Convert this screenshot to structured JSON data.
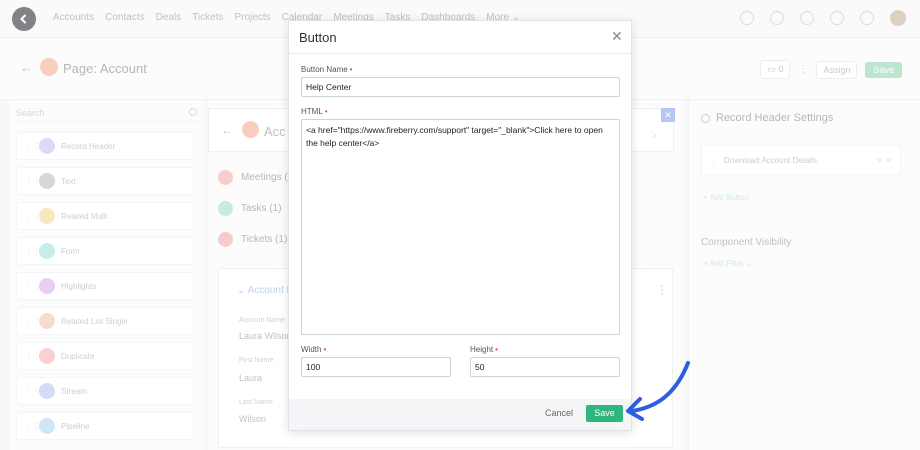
{
  "topnav": {
    "links": [
      "Accounts",
      "Contacts",
      "Deals",
      "Tickets",
      "Projects",
      "Calendar",
      "Meetings",
      "Tasks",
      "Dashboards",
      "More ⌄"
    ]
  },
  "pagebar": {
    "title": "Page: Account",
    "assign_label": "Assign",
    "save_label": "Save",
    "device_count": "0"
  },
  "left_panel": {
    "search_placeholder": "Search",
    "components": [
      {
        "label": "Record Header",
        "color": "#c7c9f3"
      },
      {
        "label": "Text",
        "color": "#bfc2c7"
      },
      {
        "label": "Related Multi",
        "color": "#f5dc9a"
      },
      {
        "label": "Form",
        "color": "#a9e3dd"
      },
      {
        "label": "Highlights",
        "color": "#d9b7ef"
      },
      {
        "label": "Related List Single",
        "color": "#f3c9b1"
      },
      {
        "label": "Duplicate",
        "color": "#f6b9b9"
      },
      {
        "label": "Stream",
        "color": "#c2c6f2"
      },
      {
        "label": "Pipeline",
        "color": "#b5d9f2"
      }
    ]
  },
  "mid_panel": {
    "header_title": "Acc",
    "related": [
      {
        "label": "Meetings (1",
        "color": "#f6b3b3"
      },
      {
        "label": "Tasks (1)",
        "color": "#a9e3c6"
      },
      {
        "label": "Tickets (1)",
        "color": "#f3b0b0"
      }
    ],
    "card_title": "Account De",
    "fields": [
      {
        "label": "Account Name",
        "value": "Laura Wilson"
      },
      {
        "label": "First Name",
        "value": "Laura"
      },
      {
        "label": "Last Name",
        "value": "Wilson"
      }
    ]
  },
  "right_panel": {
    "title": "Record Header Settings",
    "button_item": "Download Account Details",
    "add_button": "+ Add Button",
    "visibility_title": "Component Visibility",
    "add_filter": "+ Add Filter ⌄"
  },
  "modal": {
    "title": "Button",
    "name_label": "Button Name",
    "name_value": "Help Center",
    "html_label": "HTML",
    "html_value": "<a href=\"https://www.fireberry.com/support\" target=\"_blank\">Click here to open the help center</a>",
    "width_label": "Width",
    "width_value": "100",
    "height_label": "Height",
    "height_value": "50",
    "required_mark": "•",
    "cancel_label": "Cancel",
    "save_label": "Save"
  },
  "colors": {
    "accent_green": "#2eb67d",
    "arrow_blue": "#2c5fe0",
    "required_red": "#e0435a"
  }
}
